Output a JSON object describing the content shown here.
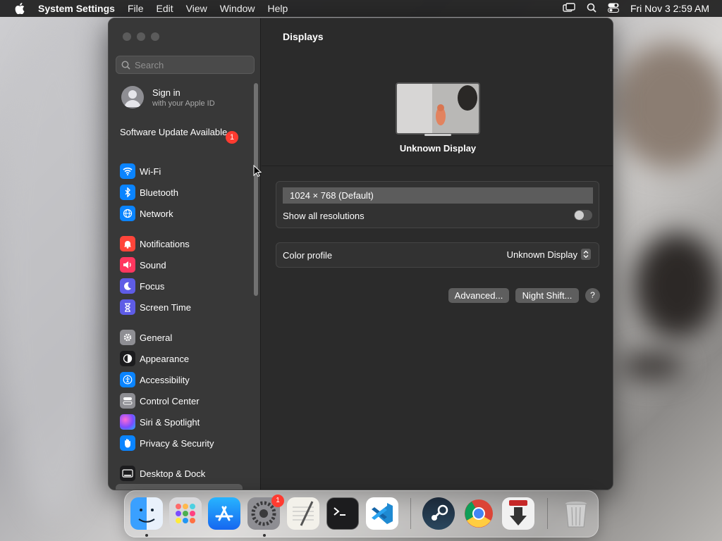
{
  "menubar": {
    "app_name": "System Settings",
    "menus": [
      "File",
      "Edit",
      "View",
      "Window",
      "Help"
    ],
    "clock": "Fri Nov 3  2:59 AM"
  },
  "sidebar": {
    "search_placeholder": "Search",
    "account": {
      "title": "Sign in",
      "subtitle": "with your Apple ID"
    },
    "update": {
      "label": "Software Update Available",
      "badge": "1"
    },
    "items": [
      {
        "label": "Wi-Fi",
        "icon": "wifi-icon",
        "color": "#0a84ff"
      },
      {
        "label": "Bluetooth",
        "icon": "bluetooth-icon",
        "color": "#0a84ff"
      },
      {
        "label": "Network",
        "icon": "globe-icon",
        "color": "#0a84ff"
      },
      {
        "label": "Notifications",
        "icon": "bell-icon",
        "color": "#ff453a"
      },
      {
        "label": "Sound",
        "icon": "speaker-icon",
        "color": "#ff375f"
      },
      {
        "label": "Focus",
        "icon": "moon-icon",
        "color": "#5e5ce6"
      },
      {
        "label": "Screen Time",
        "icon": "hourglass-icon",
        "color": "#5e5ce6"
      },
      {
        "label": "General",
        "icon": "gear-icon",
        "color": "#8e8e93"
      },
      {
        "label": "Appearance",
        "icon": "appearance-icon",
        "color": "#1c1c1e"
      },
      {
        "label": "Accessibility",
        "icon": "accessibility-icon",
        "color": "#0a84ff"
      },
      {
        "label": "Control Center",
        "icon": "control-center-icon",
        "color": "#8e8e93"
      },
      {
        "label": "Siri & Spotlight",
        "icon": "siri-icon",
        "color": "#bf5af2"
      },
      {
        "label": "Privacy & Security",
        "icon": "hand-icon",
        "color": "#0a84ff"
      },
      {
        "label": "Desktop & Dock",
        "icon": "dock-icon",
        "color": "#1c1c1e"
      }
    ]
  },
  "main": {
    "title": "Displays",
    "display_name": "Unknown Display",
    "resolution": "1024 × 768 (Default)",
    "show_all_label": "Show all resolutions",
    "show_all_on": false,
    "color_profile_label": "Color profile",
    "color_profile_value": "Unknown Display",
    "advanced_button": "Advanced...",
    "night_shift_button": "Night Shift...",
    "help_button": "?"
  },
  "dock": {
    "apps": [
      "Finder",
      "Launchpad",
      "App Store",
      "System Settings",
      "TextEdit",
      "Terminal",
      "Visual Studio Code",
      "Steam",
      "Google Chrome",
      "Transmission",
      "Trash"
    ],
    "settings_badge": "1"
  }
}
